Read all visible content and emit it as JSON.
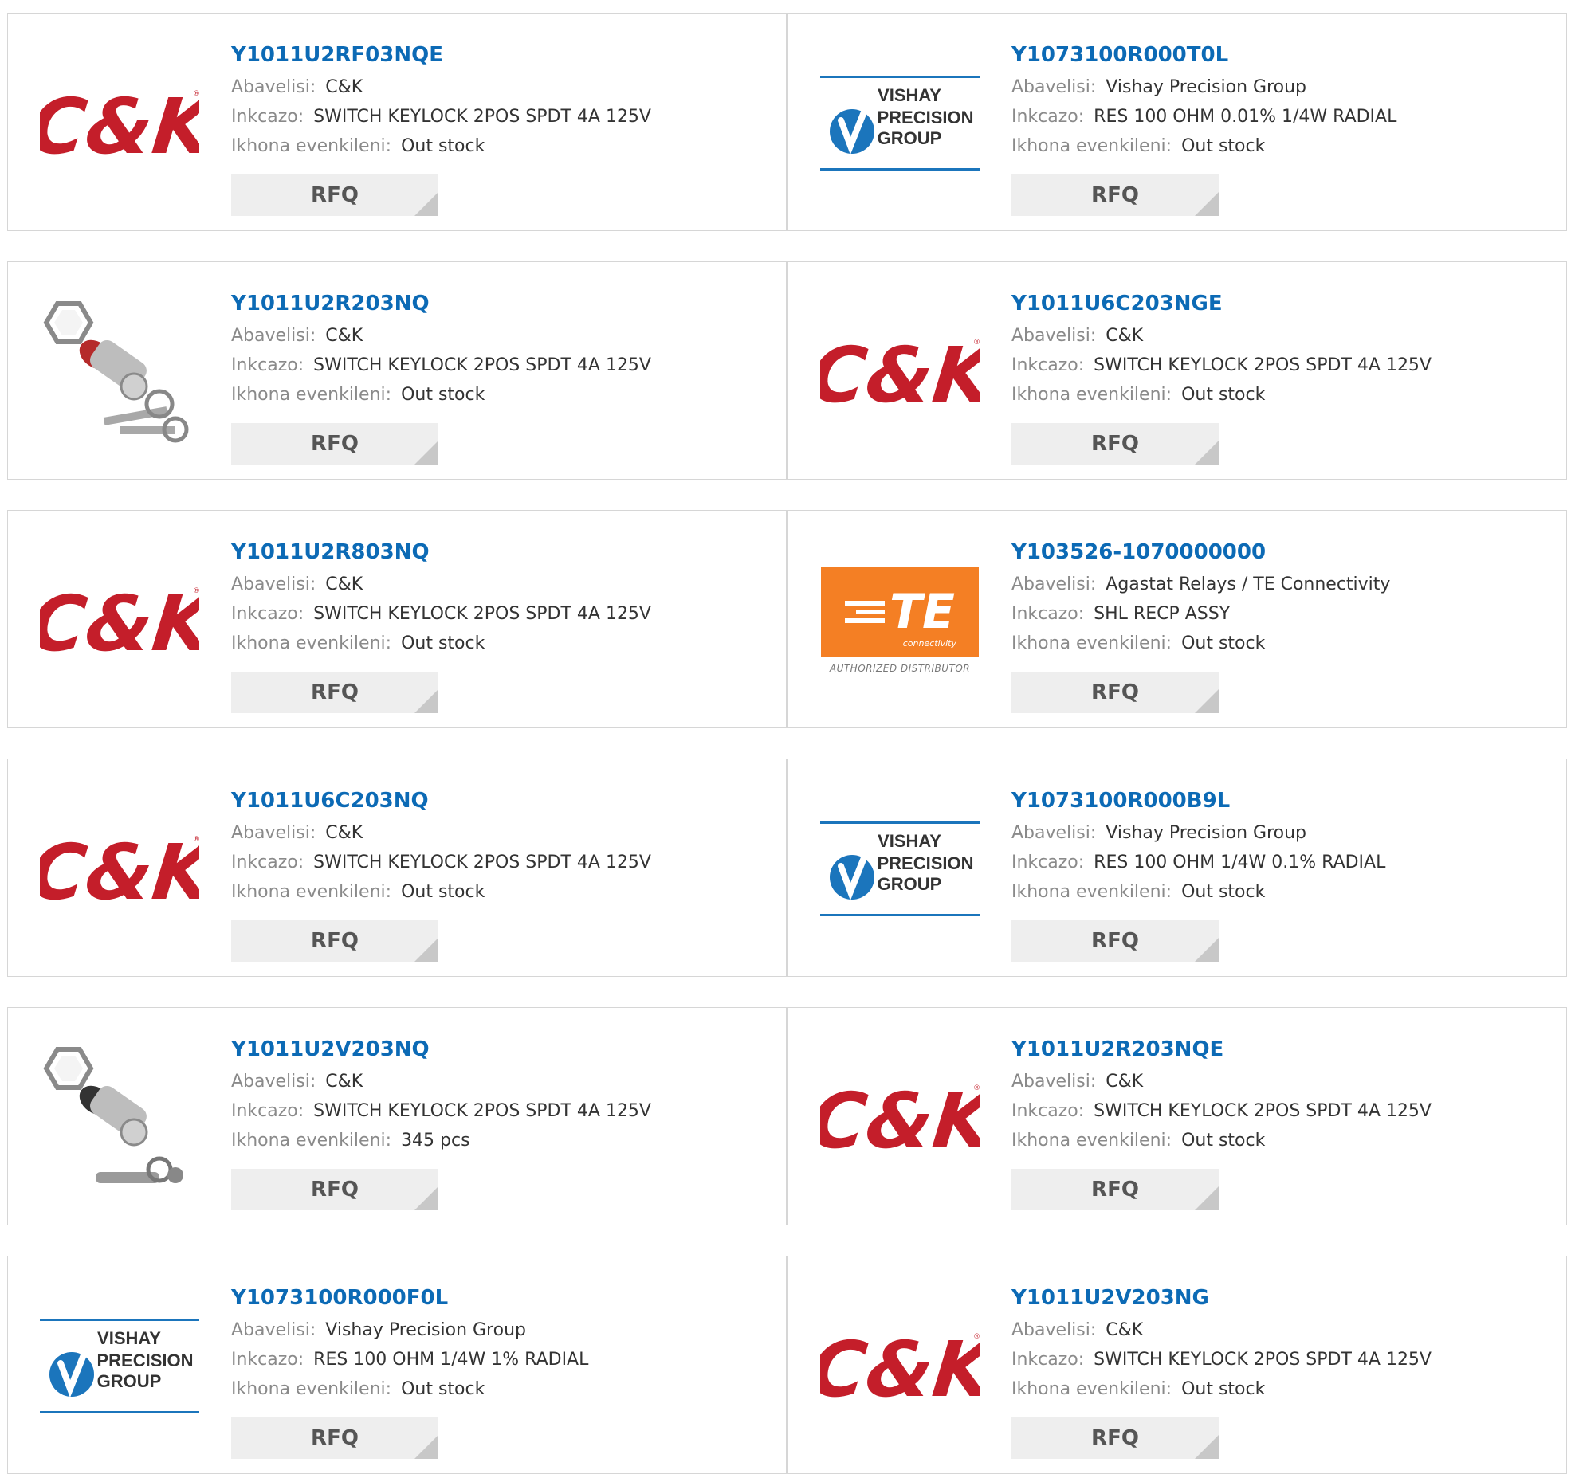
{
  "labels": {
    "manufacturer": "Abavelisi:",
    "description": "Inkcazo:",
    "stock": "Ikhona evenkileni:",
    "rfq": "RFQ"
  },
  "logos": {
    "ck": {
      "name": "ck-logo",
      "text": "C&K"
    },
    "vishay": {
      "name": "vishay-precision-logo",
      "line1": "VISHAY",
      "line2": "PRECISION",
      "line3": "GROUP"
    },
    "te": {
      "name": "te-connectivity-logo",
      "main": "TE",
      "sub": "connectivity",
      "auth": "AUTHORIZED DISTRIBUTOR"
    },
    "switch_photo": {
      "name": "keylock-switch-photo"
    },
    "switch_photo_round": {
      "name": "keylock-switch-tubular-photo"
    }
  },
  "products": [
    {
      "part": "Y1011U2RF03NQE",
      "manufacturer": "C&K",
      "description": "SWITCH KEYLOCK 2POS SPDT 4A 125V",
      "stock": "Out stock",
      "logo": "ck"
    },
    {
      "part": "Y1073100R000T0L",
      "manufacturer": "Vishay Precision Group",
      "description": "RES 100 OHM 0.01% 1/4W RADIAL",
      "stock": "Out stock",
      "logo": "vishay"
    },
    {
      "part": "Y1011U2R203NQ",
      "manufacturer": "C&K",
      "description": "SWITCH KEYLOCK 2POS SPDT 4A 125V",
      "stock": "Out stock",
      "logo": "switch_photo"
    },
    {
      "part": "Y1011U6C203NGE",
      "manufacturer": "C&K",
      "description": "SWITCH KEYLOCK 2POS SPDT 4A 125V",
      "stock": "Out stock",
      "logo": "ck"
    },
    {
      "part": "Y1011U2R803NQ",
      "manufacturer": "C&K",
      "description": "SWITCH KEYLOCK 2POS SPDT 4A 125V",
      "stock": "Out stock",
      "logo": "ck"
    },
    {
      "part": "Y103526-1070000000",
      "manufacturer": "Agastat Relays / TE Connectivity",
      "description": "SHL RECP ASSY",
      "stock": "Out stock",
      "logo": "te"
    },
    {
      "part": "Y1011U6C203NQ",
      "manufacturer": "C&K",
      "description": "SWITCH KEYLOCK 2POS SPDT 4A 125V",
      "stock": "Out stock",
      "logo": "ck"
    },
    {
      "part": "Y1073100R000B9L",
      "manufacturer": "Vishay Precision Group",
      "description": "RES 100 OHM 1/4W 0.1% RADIAL",
      "stock": "Out stock",
      "logo": "vishay"
    },
    {
      "part": "Y1011U2V203NQ",
      "manufacturer": "C&K",
      "description": "SWITCH KEYLOCK 2POS SPDT 4A 125V",
      "stock": "345 pcs",
      "logo": "switch_photo_round"
    },
    {
      "part": "Y1011U2R203NQE",
      "manufacturer": "C&K",
      "description": "SWITCH KEYLOCK 2POS SPDT 4A 125V",
      "stock": "Out stock",
      "logo": "ck"
    },
    {
      "part": "Y1073100R000F0L",
      "manufacturer": "Vishay Precision Group",
      "description": "RES 100 OHM 1/4W 1% RADIAL",
      "stock": "Out stock",
      "logo": "vishay"
    },
    {
      "part": "Y1011U2V203NG",
      "manufacturer": "C&K",
      "description": "SWITCH KEYLOCK 2POS SPDT 4A 125V",
      "stock": "Out stock",
      "logo": "ck"
    }
  ],
  "colors": {
    "part_link": "#0c6ab5",
    "ck_red": "#c41e2a",
    "vishay_blue": "#1b75bc",
    "te_orange": "#f47f24"
  }
}
